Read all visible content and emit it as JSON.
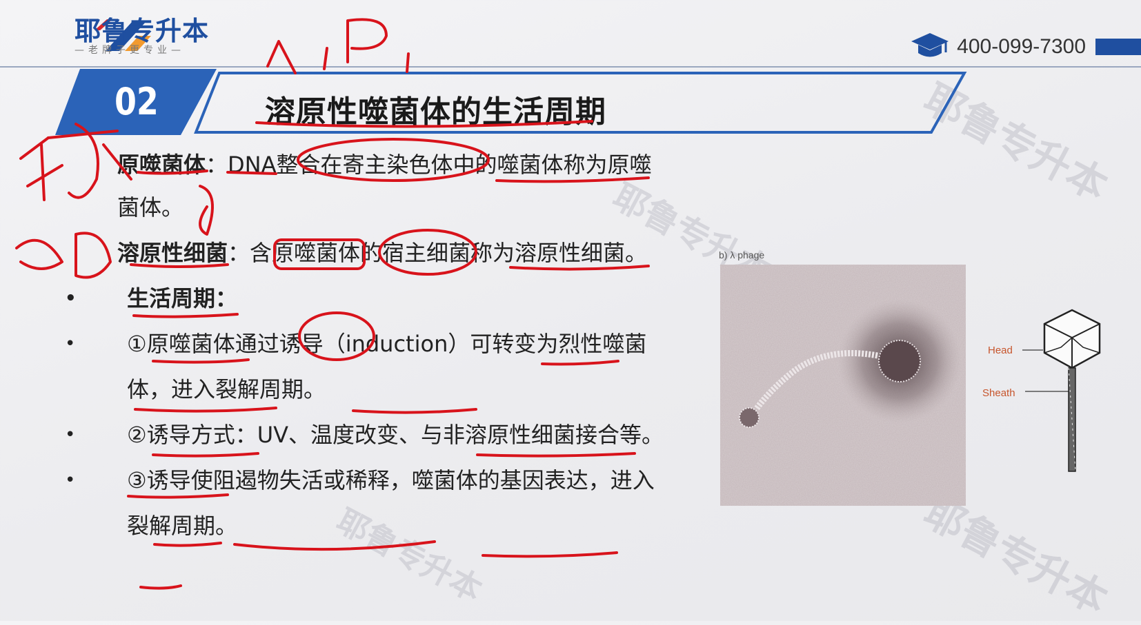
{
  "header": {
    "brand_name": "耶鲁专升本",
    "brand_slogan": "—老牌子更专业—",
    "phone": "400-099-7300"
  },
  "section": {
    "number": "02",
    "title": "溶原性噬菌体的生活周期"
  },
  "content": {
    "para1": {
      "term": "原噬菌体",
      "sep": "：",
      "text": "DNA整合在寄主染色体中的噬菌体称为原噬菌体。"
    },
    "para2": {
      "term": "溶原性细菌",
      "sep": "：",
      "text": "含原噬菌体的宿主细菌称为溶原性细菌。"
    },
    "bullets": [
      {
        "text": "生活周期：",
        "is_heading": true
      },
      {
        "text": "①原噬菌体通过诱导（induction）可转变为烈性噬菌体，进入裂解周期。",
        "is_heading": false
      },
      {
        "text": "②诱导方式：UV、温度改变、与非溶原性细菌接合等。",
        "is_heading": false
      },
      {
        "text": "③诱导使阻遏物失活或稀释，噬菌体的基因表达，进入裂解周期。",
        "is_heading": false
      }
    ]
  },
  "figure": {
    "caption": "b) λ phage",
    "label_head": "Head",
    "label_sheath": "Sheath"
  },
  "handwriting": {
    "note_top": "入P",
    "note_left1": "细菌",
    "note_left2": "DNA"
  },
  "colors": {
    "brand_blue": "#1f4fa0",
    "brand_orange": "#f29a2e",
    "ink_red": "#d8131b",
    "label_orange": "#c7552c"
  },
  "icons": [
    "graduation-cap-icon",
    "brand-slash-logo-icon"
  ]
}
